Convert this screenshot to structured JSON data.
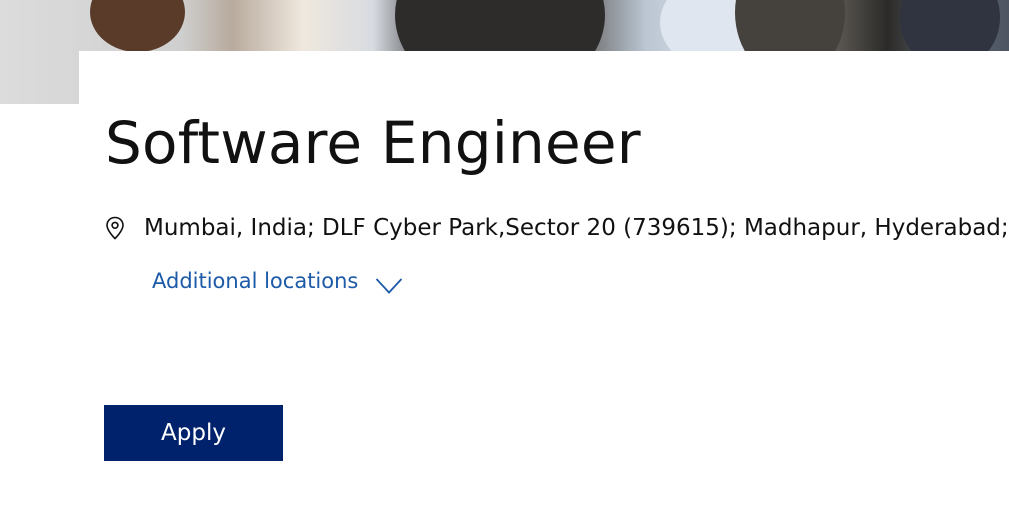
{
  "job": {
    "title": "Software Engineer",
    "locations_text": "Mumbai, India; DLF Cyber Park,Sector 20 (739615); Madhapur, Hyderabad;",
    "additional_locations_label": "Additional locations",
    "apply_label": "Apply"
  },
  "icons": {
    "location": "map-pin-icon",
    "expand": "chevron-down-icon"
  },
  "colors": {
    "link": "#1d5aa8",
    "button": "#00216b",
    "text": "#111111"
  }
}
